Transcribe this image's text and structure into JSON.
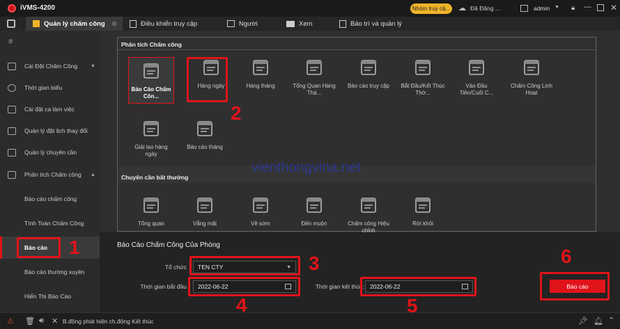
{
  "app": {
    "title": "iVMS-4200",
    "badge": "Nhóm truy cậ...",
    "status": "Đã Đăng ...",
    "user": "admin"
  },
  "tabs": [
    {
      "label": "Quản lý chấm công"
    },
    {
      "label": "Điều khiển truy cập"
    },
    {
      "label": "Người"
    },
    {
      "label": "Xem"
    },
    {
      "label": "Bảo trì và quản lý"
    }
  ],
  "sidebar": {
    "items": [
      {
        "label": "Cài Đặt Chấm Công"
      },
      {
        "label": "Thời gian biểu"
      },
      {
        "label": "Cài đặt ca làm việc"
      },
      {
        "label": "Quản lý đặt lịch thay đổi"
      },
      {
        "label": "Quản lý chuyên cần"
      },
      {
        "label": "Phân tích Chấm công"
      },
      {
        "label": "Báo cáo chấm công"
      },
      {
        "label": "Tính Toán Chấm Công"
      },
      {
        "label": "Báo cáo"
      },
      {
        "label": "Báo cáo thường xuyên"
      },
      {
        "label": "Hiển Thị Báo Cáo"
      }
    ]
  },
  "section1": {
    "title": "Phân tích Chấm công",
    "tiles": [
      {
        "label": "Báo Cáo Chấm Côn..."
      },
      {
        "label": "Hàng ngày"
      },
      {
        "label": "Hàng tháng"
      },
      {
        "label": "Tổng Quan Hàng Thá..."
      },
      {
        "label": "Báo cáo truy cập"
      },
      {
        "label": "Bắt Đầu/Kết Thúc Thờ..."
      },
      {
        "label": "Vào Đầu Tiên/Cuối C..."
      },
      {
        "label": "Chấm Công Linh Hoạt"
      },
      {
        "label": "Giải lao hàng ngày"
      },
      {
        "label": "Báo cáo tháng"
      }
    ]
  },
  "section2": {
    "title": "Chuyên cần bất thường",
    "tiles": [
      {
        "label": "Tổng quan"
      },
      {
        "label": "Vắng mặt"
      },
      {
        "label": "Về sớm"
      },
      {
        "label": "Đến muộn"
      },
      {
        "label": "Chấm công Hiệu chỉnh"
      },
      {
        "label": "Rời khỏi"
      }
    ]
  },
  "form": {
    "title": "Báo Cáo Chấm Công Của Phòng",
    "org_label": "Tổ chức",
    "org_value": "TEN CTY",
    "start_label": "Thời gian bắt đầu",
    "start_value": "2022-06-22",
    "end_label": "Thời gian kết thúc:",
    "end_value": "2022-06-22",
    "submit": "Báo cáo"
  },
  "watermark": "vienthongvina.net",
  "annotations": [
    "1",
    "2",
    "3",
    "4",
    "5",
    "6"
  ],
  "statusbar": {
    "message": "B.động phát hiện ch.động Kết thúc"
  },
  "colors": {
    "accent": "#e0141a",
    "badge": "#f0b429",
    "bg": "#232323"
  }
}
